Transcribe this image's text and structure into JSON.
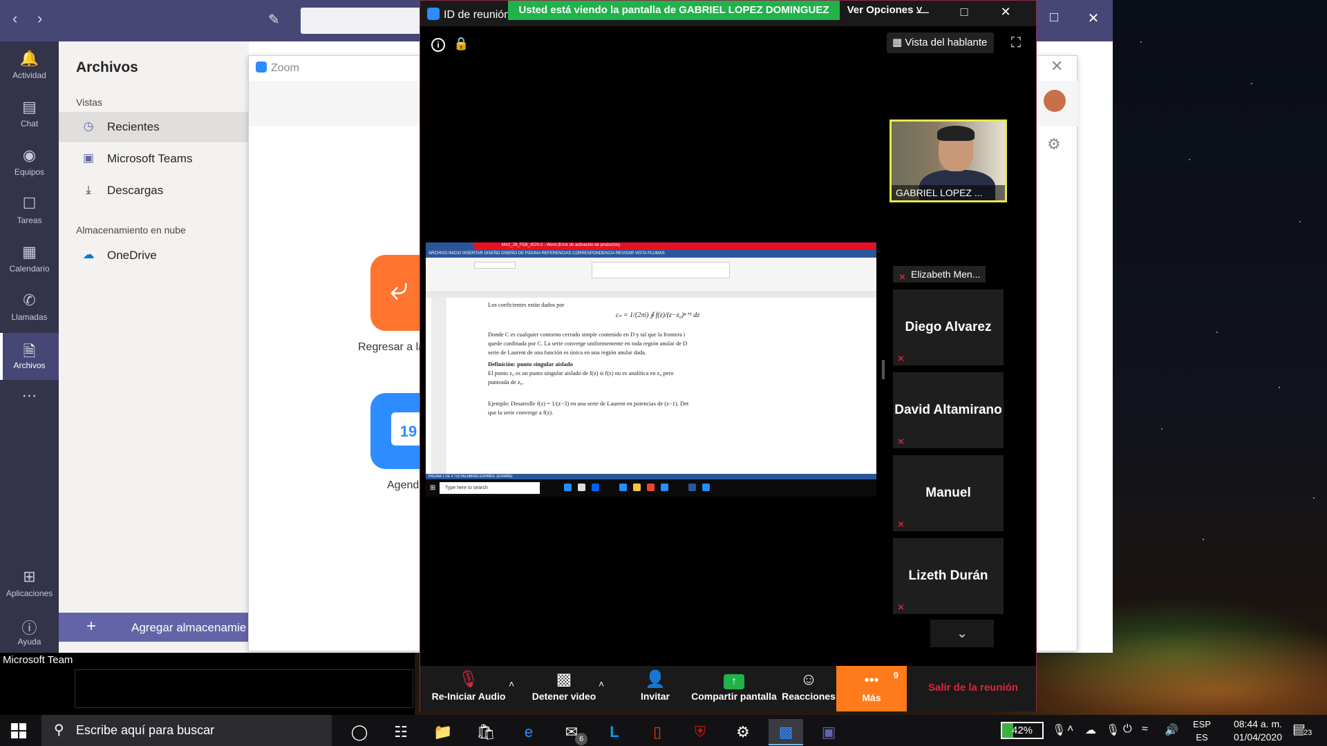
{
  "teams": {
    "rail": [
      {
        "label": "Actividad",
        "icon": "bell-icon"
      },
      {
        "label": "Chat",
        "icon": "chat-icon"
      },
      {
        "label": "Equipos",
        "icon": "teams-icon"
      },
      {
        "label": "Tareas",
        "icon": "tasks-icon"
      },
      {
        "label": "Calendario",
        "icon": "calendar-icon"
      },
      {
        "label": "Llamadas",
        "icon": "phone-icon"
      },
      {
        "label": "Archivos",
        "icon": "files-icon",
        "active": true
      },
      {
        "label": "Aplicaciones",
        "icon": "apps-icon"
      },
      {
        "label": "Ayuda",
        "icon": "help-icon"
      }
    ],
    "files_title": "Archivos",
    "views_label": "Vistas",
    "views": [
      {
        "label": "Recientes",
        "icon": "clock-icon",
        "selected": true
      },
      {
        "label": "Microsoft Teams",
        "icon": "teams-logo-icon"
      },
      {
        "label": "Descargas",
        "icon": "download-icon"
      }
    ],
    "cloud_label": "Almacenamiento en nube",
    "cloud_items": [
      {
        "label": "OneDrive",
        "icon": "onedrive-icon"
      }
    ],
    "add_storage_label": "Agregar almacenamie",
    "notify_label": "Microsoft Team"
  },
  "zoom_home": {
    "title": "Zoom",
    "tile1_label": "Regresar a la",
    "tile2_label": "Agend",
    "tile2_day": "19"
  },
  "meeting": {
    "title": "ID de reunión",
    "share_banner": "Usted está viendo la pantalla de GABRIEL LOPEZ DOMINGUEZ",
    "view_options": "Ver Opciones",
    "speaker_view": "Vista del hablante",
    "active_speaker": "GABRIEL LOPEZ ...",
    "participants": [
      {
        "name": "Elizabeth Men...",
        "video": false,
        "label_only": true
      },
      {
        "name": "Diego Alvarez"
      },
      {
        "name": "David Altamirano"
      },
      {
        "name": "Manuel"
      },
      {
        "name": "Lizeth Durán"
      }
    ],
    "toolbar": {
      "audio": "Re-Iniciar Audio",
      "video": "Detener video",
      "invite": "Invitar",
      "share": "Compartir pantalla",
      "reactions": "Reacciones",
      "more": "Más",
      "more_badge": "9",
      "leave": "Salir de la reunión"
    }
  },
  "shared_doc": {
    "title_bar": "MA2_28_FEB_2020-2 - Word (Error de activación de productos)",
    "tabs": "ARCHIVO   INICIO   INSERTAR   DISEÑO   DISEÑO DE PÁGINA   REFERENCIAS   CORRESPONDENCIA   REVISAR   VISTA   PLUMAS",
    "lines": [
      "Los coeficientes están dados por",
      "Donde C es cualquier contorno cerrado simple contenido en D y tal que la frontera i",
      "quede confinada por C. La serie converge uniformemente en toda región anular de D",
      "serie de Laurent de una función es única en una región anular dada.",
      "Definición: punto singular aislado",
      "El punto z₀ es un punto singular aislado de f(z) si f(z) no es analítica en z₀ pero",
      "punteada de z₀.",
      "Ejemplo: Desarrolle f(z) = 1/(z−3) en una serie de Laurent en potencias de (z−1). Det",
      "que la serie converge a f(z)."
    ],
    "formula": "cₙ = 1/(2πi) ∮ f(z)/(z−z₀)ⁿ⁺¹ dz",
    "status": "PÁGINA 1 DE 4   716 PALABRAS   ESPAÑOL (ESPAÑA)",
    "taskbar_search": "Type here to search"
  },
  "taskbar": {
    "search_placeholder": "Escribe aquí para buscar",
    "mail_badge": "6",
    "battery": "42%",
    "lang_top": "ESP",
    "lang_bottom": "ES",
    "time": "08:44 a. m.",
    "date": "01/04/2020",
    "notif_count": "23"
  },
  "colors": {
    "teams_purple": "#464775",
    "zoom_green": "#21b24b",
    "zoom_orange": "#ff7a1a",
    "leave_red": "#e0243a",
    "active_speaker_border": "#e9e94a"
  }
}
